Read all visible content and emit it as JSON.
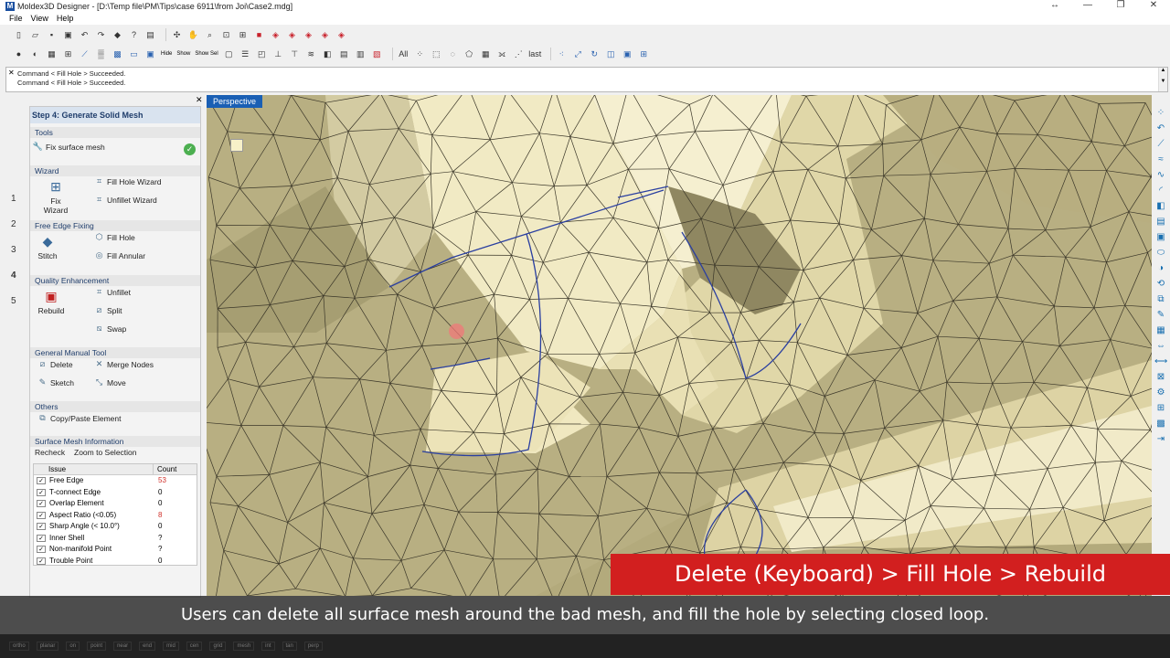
{
  "window": {
    "title": "Moldex3D Designer - [D:\\Temp file\\PM\\Tips\\case 6911\\from Joi\\Case2.mdg]",
    "app_icon": "M",
    "controls": [
      "↔",
      "—",
      "❐",
      "✕"
    ]
  },
  "menu": [
    "File",
    "View",
    "Help"
  ],
  "toolbar2_text": {
    "hide": "Hide",
    "show": "Show",
    "show_sel": "Show Sel",
    "all": "All",
    "last": "last"
  },
  "command_log": [
    "Command < Fill Hole > Succeeded.",
    "Command < Fill Hole > Succeeded."
  ],
  "left_steps": [
    "1",
    "2",
    "3",
    "4",
    "5"
  ],
  "panel": {
    "title": "Step 4: Generate Solid Mesh",
    "tools_label": "Tools",
    "fix_surface_mesh": "Fix surface mesh",
    "wizard_label": "Wizard",
    "fix_wizard": "Fix Wizard",
    "fill_hole_wizard": "Fill Hole Wizard",
    "unfillet_wizard": "Unfillet Wizard",
    "free_edge_label": "Free Edge Fixing",
    "stitch": "Stitch",
    "fill_hole": "Fill Hole",
    "fill_annular": "Fill Annular",
    "quality_label": "Quality Enhancement",
    "rebuild": "Rebuild",
    "unfillet": "Unfillet",
    "split": "Split",
    "swap": "Swap",
    "manual_label": "General Manual Tool",
    "delete": "Delete",
    "merge_nodes": "Merge Nodes",
    "sketch": "Sketch",
    "move": "Move",
    "others_label": "Others",
    "copy_paste": "Copy/Paste Element",
    "smi_label": "Surface Mesh Information",
    "recheck": "Recheck",
    "zoom_to_selection": "Zoom to Selection",
    "table_headers": [
      "Issue",
      "Count"
    ],
    "issues": [
      {
        "name": "Free Edge",
        "count": "53",
        "color": "#d0302a"
      },
      {
        "name": "T-connect Edge",
        "count": "0",
        "color": "#000000"
      },
      {
        "name": "Overlap Element",
        "count": "0",
        "color": "#000000"
      },
      {
        "name": "Aspect Ratio (<0.05)",
        "count": "8",
        "color": "#d0302a"
      },
      {
        "name": "Sharp Angle (< 10.0°)",
        "count": "0",
        "color": "#000000"
      },
      {
        "name": "Inner Shell",
        "count": "?",
        "color": "#000000"
      },
      {
        "name": "Non-manifold Point",
        "count": "?",
        "color": "#000000"
      },
      {
        "name": "Trouble Point",
        "count": "0",
        "color": "#000000"
      }
    ]
  },
  "viewport": {
    "label": "Perspective"
  },
  "banner": "Delete (Keyboard) > Fill Hole > Rebuild",
  "subtitle": "Users can delete all surface mesh around the bad mesh, and fill the hole by selecting closed loop.",
  "status_items": [
    "ortho",
    "planar",
    "on",
    "point",
    "near",
    "end",
    "mid",
    "cen",
    "grid",
    "mesh",
    "int",
    "tan",
    "perp"
  ],
  "colors": {
    "accent": "#1a5fb4",
    "banner": "#d21f1f",
    "mesh_dark": "#b0a77a",
    "mesh_light": "#f3ecc4",
    "free_edge_line": "#2a3fa0"
  }
}
